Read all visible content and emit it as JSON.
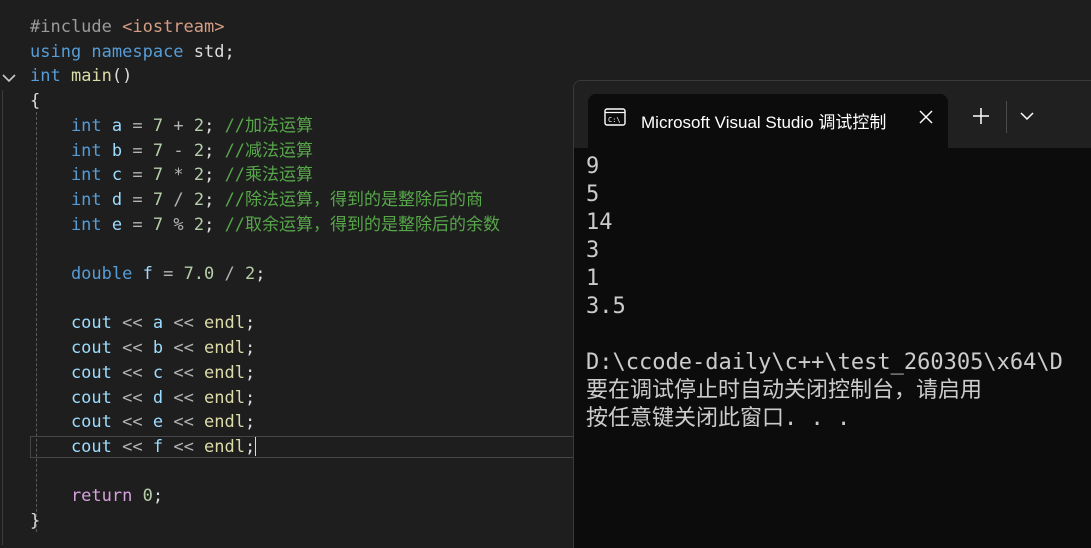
{
  "editor": {
    "lines": [
      [
        {
          "t": "#include ",
          "c": "inc"
        },
        {
          "t": "<iostream>",
          "c": "str"
        }
      ],
      [
        {
          "t": "using ",
          "c": "kw"
        },
        {
          "t": "namespace ",
          "c": "kw"
        },
        {
          "t": "std;",
          "c": "plain"
        }
      ],
      [
        {
          "t": "int ",
          "c": "kw"
        },
        {
          "t": "main",
          "c": "fn"
        },
        {
          "t": "()",
          "c": "plain"
        }
      ],
      [
        {
          "t": "{",
          "c": "plain"
        }
      ],
      [
        {
          "t": "    int ",
          "c": "kw"
        },
        {
          "t": "a",
          "c": "var"
        },
        {
          "t": " = ",
          "c": "op"
        },
        {
          "t": "7",
          "c": "num"
        },
        {
          "t": " + ",
          "c": "op"
        },
        {
          "t": "2",
          "c": "num"
        },
        {
          "t": "; ",
          "c": "plain"
        },
        {
          "t": "//加法运算",
          "c": "cmt"
        }
      ],
      [
        {
          "t": "    int ",
          "c": "kw"
        },
        {
          "t": "b",
          "c": "var"
        },
        {
          "t": " = ",
          "c": "op"
        },
        {
          "t": "7",
          "c": "num"
        },
        {
          "t": " - ",
          "c": "op"
        },
        {
          "t": "2",
          "c": "num"
        },
        {
          "t": "; ",
          "c": "plain"
        },
        {
          "t": "//减法运算",
          "c": "cmt"
        }
      ],
      [
        {
          "t": "    int ",
          "c": "kw"
        },
        {
          "t": "c",
          "c": "var"
        },
        {
          "t": " = ",
          "c": "op"
        },
        {
          "t": "7",
          "c": "num"
        },
        {
          "t": " * ",
          "c": "op"
        },
        {
          "t": "2",
          "c": "num"
        },
        {
          "t": "; ",
          "c": "plain"
        },
        {
          "t": "//乘法运算",
          "c": "cmt"
        }
      ],
      [
        {
          "t": "    int ",
          "c": "kw"
        },
        {
          "t": "d",
          "c": "var"
        },
        {
          "t": " = ",
          "c": "op"
        },
        {
          "t": "7",
          "c": "num"
        },
        {
          "t": " / ",
          "c": "op"
        },
        {
          "t": "2",
          "c": "num"
        },
        {
          "t": "; ",
          "c": "plain"
        },
        {
          "t": "//除法运算，得到的是整除后的商",
          "c": "cmt"
        }
      ],
      [
        {
          "t": "    int ",
          "c": "kw"
        },
        {
          "t": "e",
          "c": "var"
        },
        {
          "t": " = ",
          "c": "op"
        },
        {
          "t": "7",
          "c": "num"
        },
        {
          "t": " % ",
          "c": "op"
        },
        {
          "t": "2",
          "c": "num"
        },
        {
          "t": "; ",
          "c": "plain"
        },
        {
          "t": "//取余运算，得到的是整除后的余数",
          "c": "cmt"
        }
      ],
      [],
      [
        {
          "t": "    double ",
          "c": "kw"
        },
        {
          "t": "f",
          "c": "var"
        },
        {
          "t": " = ",
          "c": "op"
        },
        {
          "t": "7.0",
          "c": "num"
        },
        {
          "t": " / ",
          "c": "op"
        },
        {
          "t": "2",
          "c": "num"
        },
        {
          "t": ";",
          "c": "plain"
        }
      ],
      [],
      [
        {
          "t": "    cout",
          "c": "var"
        },
        {
          "t": " << ",
          "c": "op"
        },
        {
          "t": "a",
          "c": "var"
        },
        {
          "t": " << ",
          "c": "op"
        },
        {
          "t": "endl",
          "c": "fn"
        },
        {
          "t": ";",
          "c": "plain"
        }
      ],
      [
        {
          "t": "    cout",
          "c": "var"
        },
        {
          "t": " << ",
          "c": "op"
        },
        {
          "t": "b",
          "c": "var"
        },
        {
          "t": " << ",
          "c": "op"
        },
        {
          "t": "endl",
          "c": "fn"
        },
        {
          "t": ";",
          "c": "plain"
        }
      ],
      [
        {
          "t": "    cout",
          "c": "var"
        },
        {
          "t": " << ",
          "c": "op"
        },
        {
          "t": "c",
          "c": "var"
        },
        {
          "t": " << ",
          "c": "op"
        },
        {
          "t": "endl",
          "c": "fn"
        },
        {
          "t": ";",
          "c": "plain"
        }
      ],
      [
        {
          "t": "    cout",
          "c": "var"
        },
        {
          "t": " << ",
          "c": "op"
        },
        {
          "t": "d",
          "c": "var"
        },
        {
          "t": " << ",
          "c": "op"
        },
        {
          "t": "endl",
          "c": "fn"
        },
        {
          "t": ";",
          "c": "plain"
        }
      ],
      [
        {
          "t": "    cout",
          "c": "var"
        },
        {
          "t": " << ",
          "c": "op"
        },
        {
          "t": "e",
          "c": "var"
        },
        {
          "t": " << ",
          "c": "op"
        },
        {
          "t": "endl",
          "c": "fn"
        },
        {
          "t": ";",
          "c": "plain"
        }
      ],
      [
        {
          "t": "    cout",
          "c": "var"
        },
        {
          "t": " << ",
          "c": "op"
        },
        {
          "t": "f",
          "c": "var"
        },
        {
          "t": " << ",
          "c": "op"
        },
        {
          "t": "endl",
          "c": "fn"
        },
        {
          "t": ";",
          "c": "plain"
        },
        {
          "t": "",
          "c": "caret"
        }
      ],
      [],
      [
        {
          "t": "    return ",
          "c": "ctrl"
        },
        {
          "t": "0",
          "c": "num"
        },
        {
          "t": ";",
          "c": "plain"
        }
      ],
      [
        {
          "t": "}",
          "c": "plain"
        }
      ]
    ]
  },
  "console": {
    "tab_title": "Microsoft Visual Studio 调试控制台",
    "tab_icon": "terminal-icon",
    "close_icon": "close-icon",
    "new_tab_icon": "plus-icon",
    "dropdown_icon": "chevron-down-icon",
    "output": [
      "9",
      "5",
      "14",
      "3",
      "1",
      "3.5",
      "",
      "D:\\ccode-daily\\c++\\test_260305\\x64\\D",
      "要在调试停止时自动关闭控制台，请启用",
      "按任意键关闭此窗口. . ."
    ]
  },
  "colors": {
    "editor_bg": "#1e1e1e",
    "console_bg": "#0c0c0c",
    "titlebar_bg": "#202020",
    "keyword": "#569cd6",
    "comment": "#57a64a",
    "number": "#b5cea8",
    "variable": "#9cdcfe",
    "function": "#dcdcaa"
  }
}
